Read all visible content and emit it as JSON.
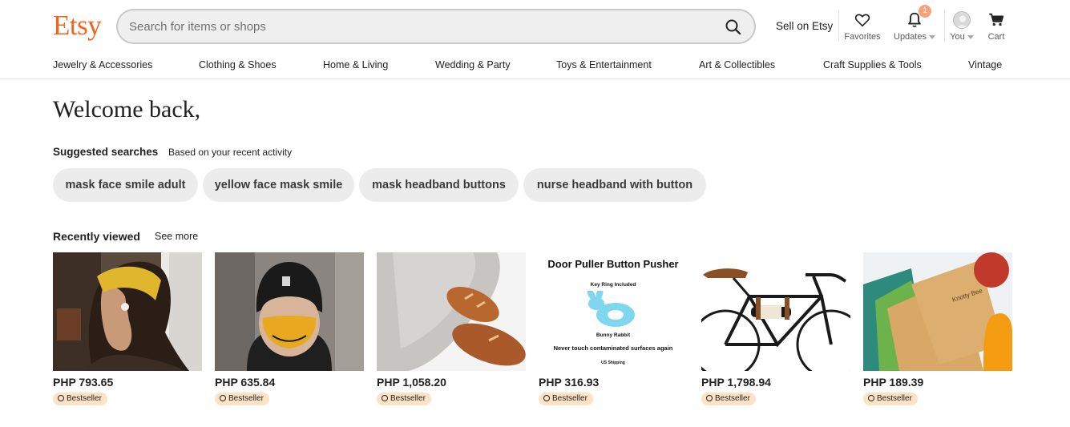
{
  "header": {
    "logo": "Etsy",
    "search_placeholder": "Search for items or shops",
    "sell_label": "Sell on Etsy",
    "favorites_label": "Favorites",
    "updates_label": "Updates",
    "updates_count": "1",
    "you_label": "You",
    "cart_label": "Cart"
  },
  "nav": {
    "items": [
      "Jewelry & Accessories",
      "Clothing & Shoes",
      "Home & Living",
      "Wedding & Party",
      "Toys & Entertainment",
      "Art & Collectibles",
      "Craft Supplies & Tools",
      "Vintage"
    ]
  },
  "welcome": "Welcome back,",
  "suggested": {
    "title": "Suggested searches",
    "subtitle": "Based on your recent activity",
    "chips": [
      "mask face smile adult",
      "yellow face mask smile",
      "mask headband buttons",
      "nurse headband with button"
    ]
  },
  "recent": {
    "title": "Recently viewed",
    "see_more": "See more",
    "items": [
      {
        "price": "PHP 793.65",
        "badge": "Bestseller",
        "image": "headband-with-buttons-photo"
      },
      {
        "price": "PHP 635.84",
        "badge": "Bestseller",
        "image": "yellow-face-mask-photo"
      },
      {
        "price": "PHP 1,058.20",
        "badge": "Bestseller",
        "image": "bread-bag-photo"
      },
      {
        "price": "PHP 316.93",
        "badge": "Bestseller",
        "image": "door-puller-poster",
        "poster": {
          "title": "Door Puller Button Pusher",
          "line1": "Key Ring Included",
          "line2": "Bunny Rabbit",
          "line3": "Never touch contaminated surfaces again",
          "line4": "US Shipping"
        }
      },
      {
        "price": "PHP 1,798.94",
        "badge": "Bestseller",
        "image": "bike-wine-holder-photo"
      },
      {
        "price": "PHP 189.39",
        "badge": "Bestseller",
        "image": "beeswax-wraps-photo",
        "package_text": "Knotty Bee"
      }
    ]
  },
  "colors": {
    "brand": "#f1641e",
    "chip_bg": "#ececec",
    "badge_bg": "#fde2c6",
    "notification": "#f6a27a"
  }
}
